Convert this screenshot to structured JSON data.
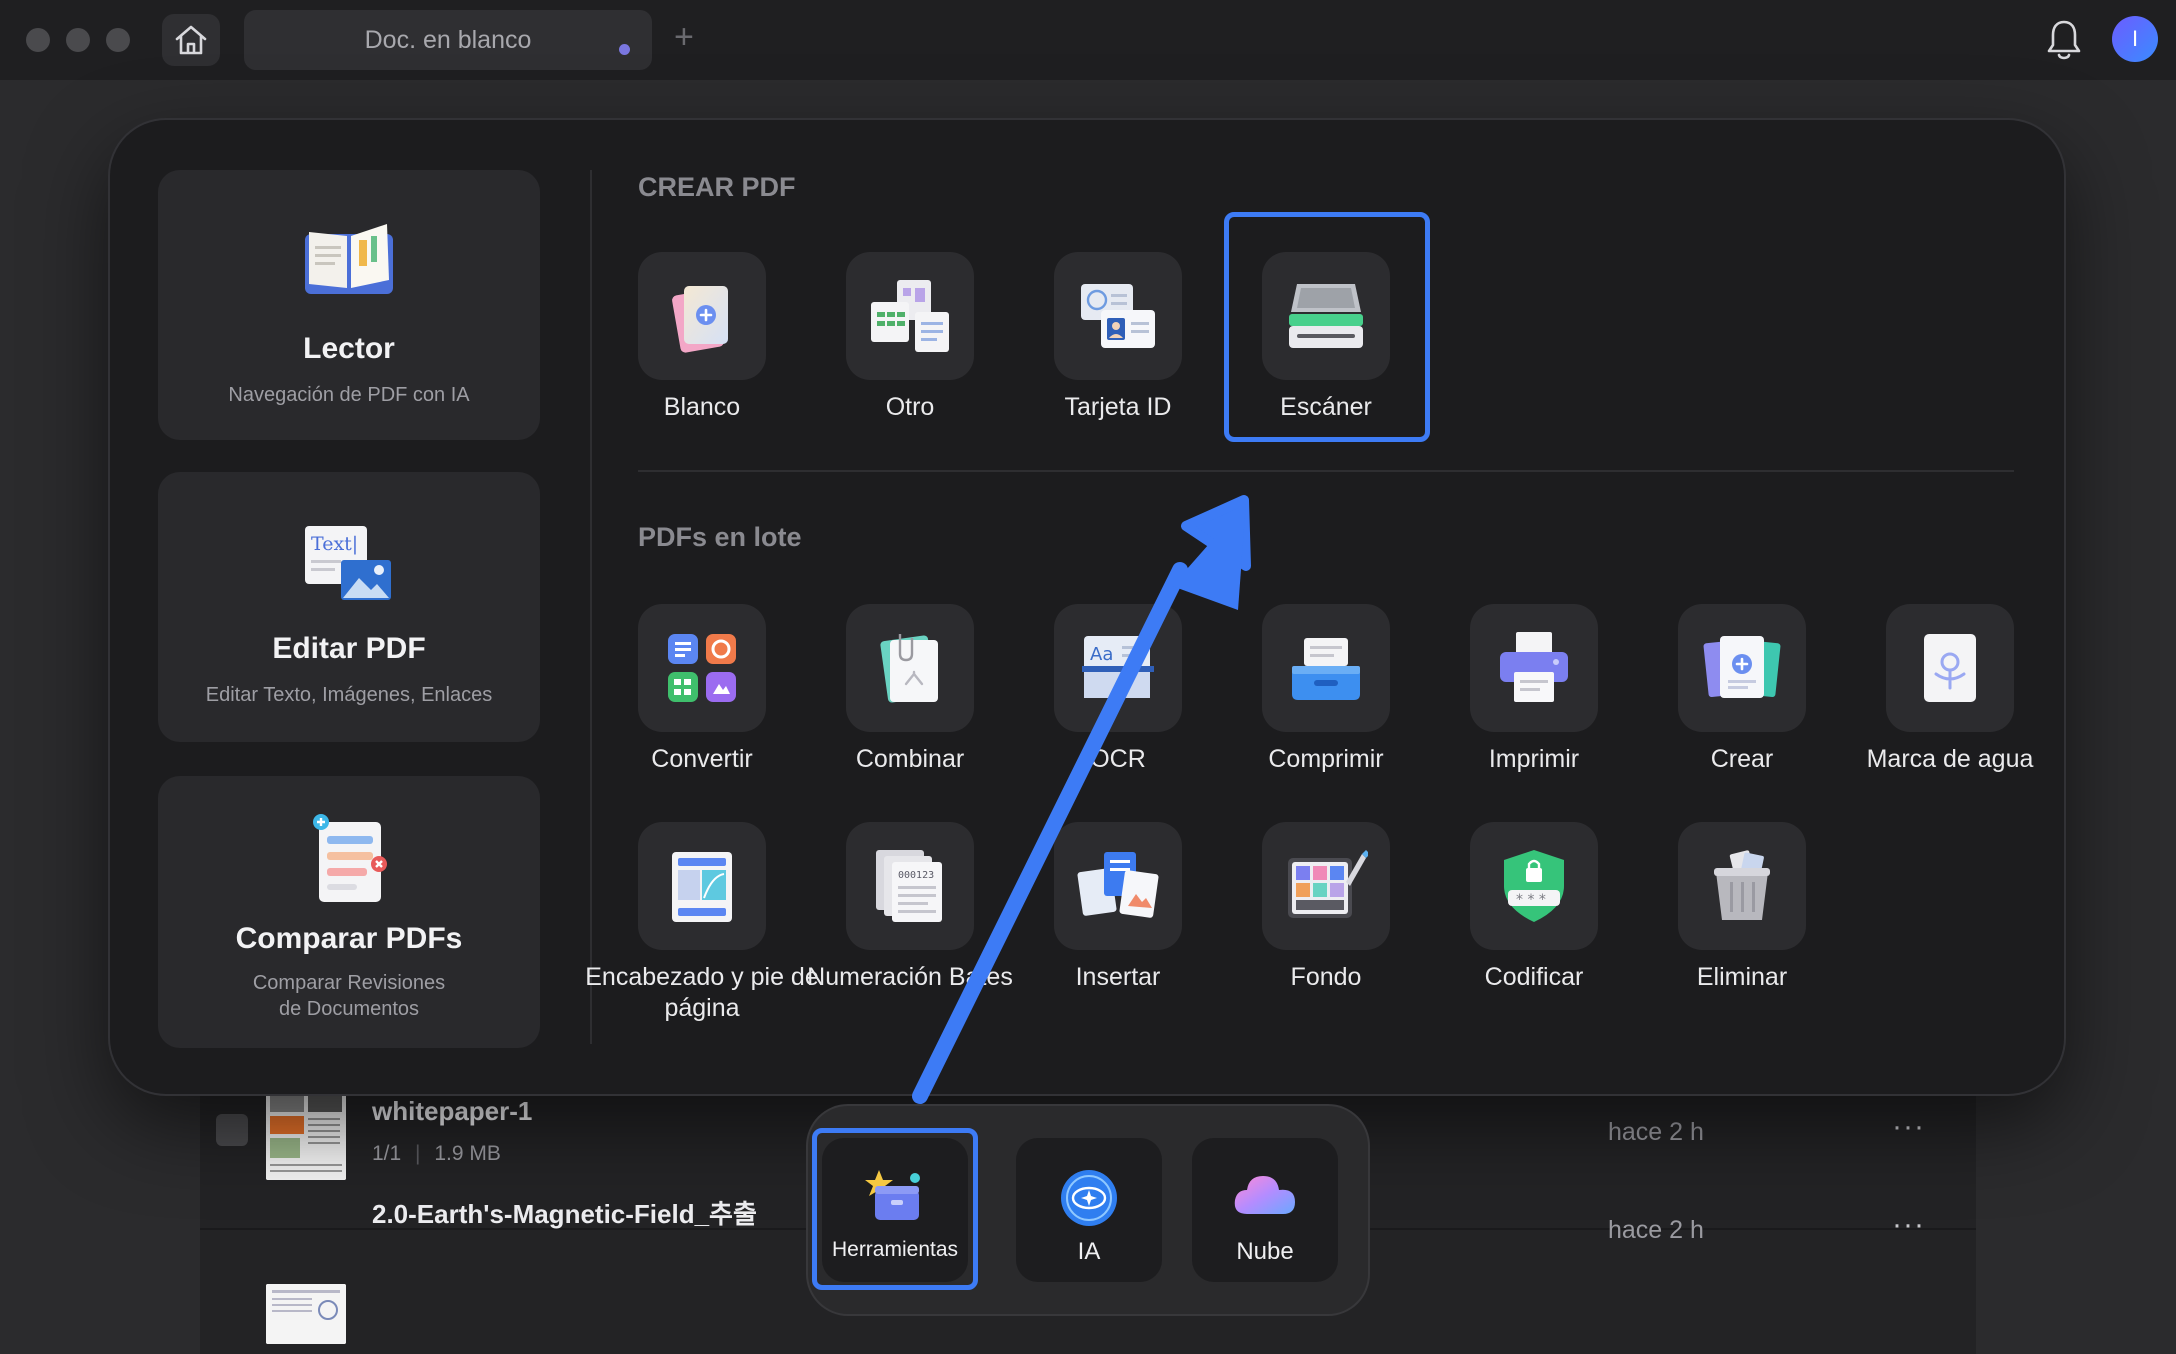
{
  "titlebar": {
    "tab_label": "Doc. en blanco",
    "new_tab_symbol": "+",
    "avatar_initial": "I"
  },
  "sidebar": {
    "lector": {
      "title": "Lector",
      "subtitle": "Navegación de PDF con IA"
    },
    "editar": {
      "title": "Editar PDF",
      "subtitle": "Editar Texto, Imágenes, Enlaces",
      "icon_text": "Text|"
    },
    "comparar": {
      "title": "Comparar PDFs",
      "subtitle_line1": "Comparar Revisiones",
      "subtitle_line2": "de Documentos"
    }
  },
  "crear_pdf": {
    "title": "CREAR PDF",
    "tools": [
      {
        "label": "Blanco"
      },
      {
        "label": "Otro"
      },
      {
        "label": "Tarjeta ID"
      },
      {
        "label": "Escáner"
      }
    ]
  },
  "lote": {
    "title": "PDFs en lote",
    "tools": [
      {
        "label": "Convertir"
      },
      {
        "label": "Combinar"
      },
      {
        "label": "OCR"
      },
      {
        "label": "Comprimir"
      },
      {
        "label": "Imprimir"
      },
      {
        "label": "Crear"
      },
      {
        "label": "Marca de agua"
      },
      {
        "label": "Encabezado y pie de página"
      },
      {
        "label": "Numeración Bates"
      },
      {
        "label": "Insertar"
      },
      {
        "label": "Fondo"
      },
      {
        "label": "Codificar"
      },
      {
        "label": "Eliminar"
      }
    ]
  },
  "files": [
    {
      "name": "whitepaper-1",
      "pages": "1/1",
      "size": "1.9 MB",
      "time": "hace 2 h",
      "more": "···"
    },
    {
      "name": "2.0-Earth's-Magnetic-Field_추출",
      "time": "hace 2 h",
      "more": "···"
    }
  ],
  "dock": {
    "tools_label": "Herramientas",
    "ai_label": "IA",
    "cloud_label": "Nube"
  },
  "colors": {
    "accent": "#3d7bf5",
    "background": "#2b2b2d",
    "panel": "#1c1c1e"
  }
}
